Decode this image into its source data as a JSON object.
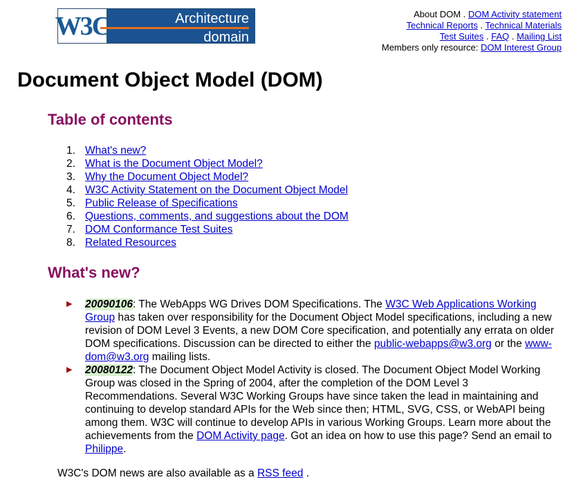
{
  "logo": {
    "w3c": "W3C",
    "line1": "Architecture",
    "line2": "domain"
  },
  "topnav": {
    "row1_prefix": "About DOM",
    "activity_statement": "DOM Activity statement",
    "technical_reports": "Technical Reports",
    "technical_materials": "Technical Materials",
    "test_suites": "Test Suites",
    "faq": "FAQ",
    "mailing_list": "Mailing List",
    "members_prefix": "Members only resource:",
    "interest_group": "DOM Interest Group",
    "sep": " . "
  },
  "page_title": "Document Object Model (DOM)",
  "toc": {
    "heading": "Table of contents",
    "items": [
      {
        "num": "1.",
        "label": "What's new?"
      },
      {
        "num": "2.",
        "label": "What is the Document Object Model?"
      },
      {
        "num": "3.",
        "label": "Why the Document Object Model?"
      },
      {
        "num": "4.",
        "label": "W3C Activity Statement on the Document Object Model"
      },
      {
        "num": "5.",
        "label": "Public Release of Specifications"
      },
      {
        "num": "6.",
        "label": "Questions, comments, and suggestions about the DOM"
      },
      {
        "num": "7.",
        "label": "DOM Conformance Test Suites"
      },
      {
        "num": "8.",
        "label": "Related Resources"
      }
    ]
  },
  "whats_new": {
    "heading": "What's new?",
    "item1": {
      "date": "20090106",
      "text_a": ": The WebApps WG Drives DOM Specifications. The ",
      "link_a": "W3C Web Applications Working Group",
      "text_b": " has taken over responsibility for the Document Object Model specifications, including a new revision of DOM Level 3 Events, a new DOM Core specification, and potentially any errata on older DOM specifications. Discussion can be directed to either the ",
      "link_b": "public-webapps@w3.org",
      "text_c": " or the ",
      "link_c": "www-dom@w3.org",
      "text_d": " mailing lists."
    },
    "item2": {
      "date": "20080122",
      "text_a": ": The Document Object Model Activity is closed. The Document Object Model Working Group was closed in the Spring of 2004, after the completion of the DOM Level 3 Recommendations. Several W3C Working Groups have since taken the lead in maintaining and continuing to develop standard APIs for the Web since then; HTML, SVG, CSS, or WebAPI being among them. W3C will continue to develop APIs in various Working Groups. Learn more about the achievements from the ",
      "link_a": "DOM Activity page",
      "text_b": ". Got an idea on how to use this page? Send an email to ",
      "link_b": "Philippe",
      "text_c": "."
    }
  },
  "rss": {
    "prefix": "W3C's DOM news are also available as a ",
    "link": "RSS feed",
    "suffix": " ."
  },
  "colors": {
    "heading": "#8a1060",
    "link": "#0000cc",
    "date_bg": "#d8f0d0",
    "arrow": "#a01010"
  },
  "icons": {
    "bullet": "triangle-right-icon"
  }
}
